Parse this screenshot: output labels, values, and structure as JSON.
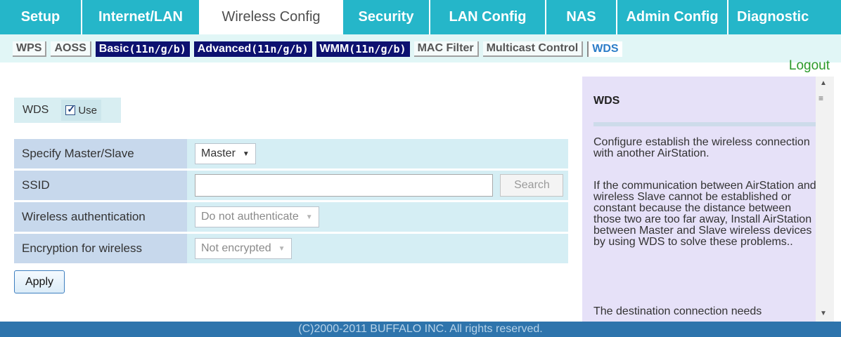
{
  "main_nav": {
    "tabs": [
      {
        "label": "Setup",
        "active": false
      },
      {
        "label": "Internet/LAN",
        "active": false
      },
      {
        "label": "Wireless Config",
        "active": true
      },
      {
        "label": "Security",
        "active": false
      },
      {
        "label": "LAN Config",
        "active": false
      },
      {
        "label": "NAS",
        "active": false
      },
      {
        "label": "Admin Config",
        "active": false
      },
      {
        "label": "Diagnostic",
        "active": false
      }
    ]
  },
  "sub_nav": {
    "tabs": [
      {
        "label": "WPS",
        "style": "plain"
      },
      {
        "label": "AOSS",
        "style": "plain"
      },
      {
        "label": "Basic",
        "suffix": "(11n/g/b)",
        "style": "dark"
      },
      {
        "label": "Advanced",
        "suffix": "(11n/g/b)",
        "style": "dark"
      },
      {
        "label": "WMM",
        "suffix": "(11n/g/b)",
        "style": "dark"
      },
      {
        "label": "MAC Filter",
        "style": "plain"
      },
      {
        "label": "Multicast Control",
        "style": "plain"
      },
      {
        "label": "WDS",
        "style": "current"
      }
    ],
    "logout_label": "Logout"
  },
  "wds": {
    "label": "WDS",
    "use_label": "Use",
    "use_checked": true
  },
  "settings": {
    "master_slave": {
      "label": "Specify Master/Slave",
      "value": "Master"
    },
    "ssid": {
      "label": "SSID",
      "value": "",
      "search_label": "Search"
    },
    "auth": {
      "label": "Wireless authentication",
      "value": "Do not authenticate"
    },
    "encryption": {
      "label": "Encryption for wireless",
      "value": "Not encrypted"
    }
  },
  "apply_label": "Apply",
  "help": {
    "title": "WDS",
    "para1": "Configure establish the wireless connection with another AirStation.",
    "para2": "If the communication between AirStation and wireless Slave cannot be established or constant because the distance between those two are too far away, Install AirStation between Master and Slave wireless devices by using WDS to solve these problems..",
    "para3": "The destination connection needs"
  },
  "footer": "(C)2000-2011 BUFFALO INC. All rights reserved.",
  "colors": {
    "nav_teal": "#25b6c9",
    "sub_nav_bg": "#e1f6f6",
    "dark_tab": "#0d1170",
    "help_bg": "#e6e1f8",
    "footer_bg": "#2e74ac",
    "logout_green": "#2a9a2a"
  }
}
